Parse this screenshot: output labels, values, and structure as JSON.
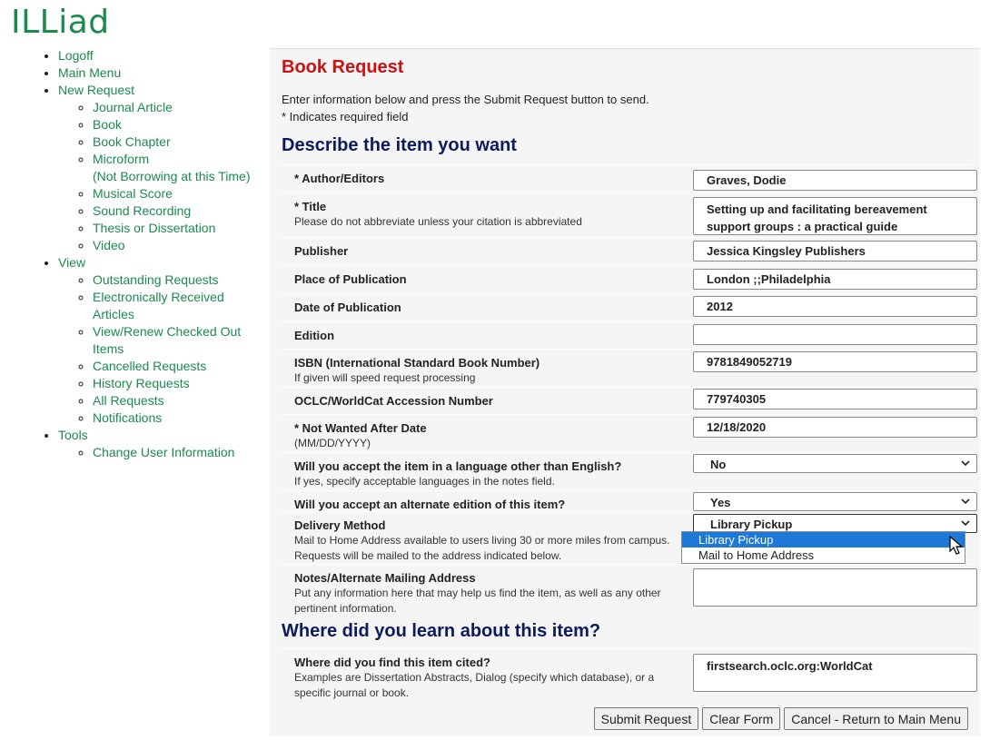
{
  "app": {
    "logo": "ILLiad"
  },
  "nav": {
    "logoff": "Logoff",
    "main_menu": "Main Menu",
    "new_request": "New Request",
    "new_request_items": [
      "Journal Article",
      "Book",
      "Book Chapter",
      "Microform",
      "Musical Score",
      "Sound Recording",
      "Thesis or Dissertation",
      "Video"
    ],
    "microform_note": "(Not Borrowing at this Time)",
    "view": "View",
    "view_items": [
      "Outstanding Requests",
      "Electronically Received Articles",
      "View/Renew Checked Out Items",
      "Cancelled Requests",
      "History Requests",
      "All Requests",
      "Notifications"
    ],
    "tools": "Tools",
    "tools_items": [
      "Change User Information"
    ]
  },
  "form": {
    "title": "Book Request",
    "intro_line1": "Enter information below and press the Submit Request button to send.",
    "intro_line2": "* Indicates required field",
    "section1": "Describe the item you want",
    "section2": "Where did you learn about this item?",
    "fields": {
      "author": {
        "label": "* Author/Editors",
        "value": "Graves, Dodie"
      },
      "title": {
        "label": "* Title",
        "help": "Please do not abbreviate unless your citation is abbreviated",
        "value": "Setting up and facilitating bereavement support groups : a practical guide"
      },
      "publisher": {
        "label": "Publisher",
        "value": "Jessica Kingsley Publishers"
      },
      "place": {
        "label": "Place of Publication",
        "value": "London ;;Philadelphia"
      },
      "date": {
        "label": "Date of Publication",
        "value": "2012"
      },
      "edition": {
        "label": "Edition",
        "value": ""
      },
      "isbn": {
        "label": "ISBN (International Standard Book Number)",
        "help": "If given will speed request processing",
        "value": "9781849052719"
      },
      "oclc": {
        "label": "OCLC/WorldCat Accession Number",
        "value": "779740305"
      },
      "nwad": {
        "label": "* Not Wanted After Date",
        "help": "(MM/DD/YYYY)",
        "value": "12/18/2020"
      },
      "language": {
        "label": "Will you accept the item in a language other than English?",
        "help": "If yes, specify acceptable languages in the notes field.",
        "value": "No"
      },
      "alternate": {
        "label": "Will you accept an alternate edition of this item?",
        "value": "Yes"
      },
      "delivery": {
        "label": "Delivery Method",
        "help": "Mail to Home Address available to users living 30 or more miles from campus. Requests will be mailed to the address indicated below.",
        "value": "Library Pickup",
        "options": [
          "Library Pickup",
          "Mail to Home Address"
        ]
      },
      "notes": {
        "label": "Notes/Alternate Mailing Address",
        "help": "Put any information here that may help us find the item, as well as any other pertinent information.",
        "value": ""
      },
      "cited": {
        "label": "Where did you find this item cited?",
        "help": "Examples are Dissertation Abstracts, Dialog (specify which database), or a specific journal or book.",
        "value": "firstsearch.oclc.org:WorldCat"
      }
    },
    "buttons": {
      "submit": "Submit Request",
      "clear": "Clear Form",
      "cancel": "Cancel - Return to Main Menu"
    }
  }
}
